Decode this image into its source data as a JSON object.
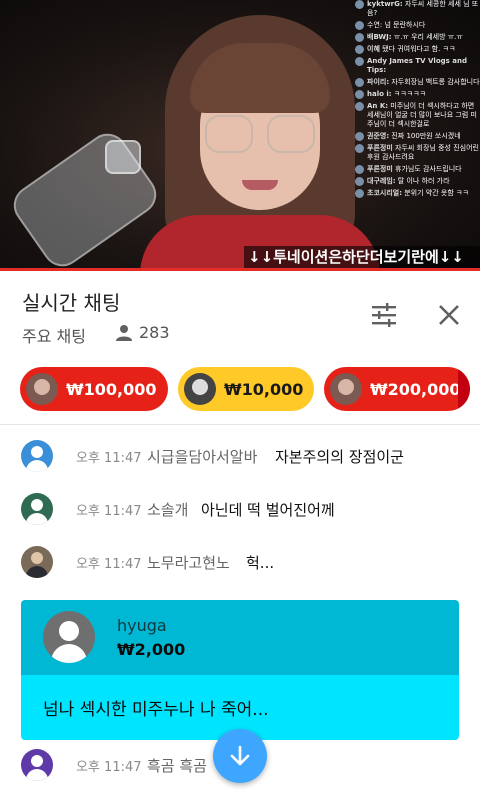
{
  "video": {
    "banner": "↓↓투네이션은하단더보기란에↓↓",
    "overlay_chat": [
      {
        "name": "kyktwrG:",
        "text": "자두씨 세콩한 세세 님 또 음?"
      },
      {
        "name": "",
        "text": "수연: 넘 문란하시다"
      },
      {
        "name": "배BWJ:",
        "text": "ㅠ.ㅠ 우리 세세방 ㅠ.ㅠ"
      },
      {
        "name": "이혜",
        "text": "됐다 귀여워다고 함. ㅋㅋ"
      },
      {
        "name": "Andy James TV Vlogs and Tips:",
        "text": ""
      },
      {
        "name": "파이리:",
        "text": "자두회장님 백트롱 감사합니다"
      },
      {
        "name": "halo i:",
        "text": "ㅋㅋㅋㅋㅋ"
      },
      {
        "name": "An K:",
        "text": "미주님이 더 섹시하다고 하면 세세님이 얼굴 더 많이 보나요 그럼 미주님이 더 섹시한걸로"
      },
      {
        "name": "권준영:",
        "text": "진짜 100만원 쏘시겠네"
      },
      {
        "name": "푸른정미",
        "text": "자두씨 회장님 중성 진심어린 후원 감사드려요"
      },
      {
        "name": "푸른정미",
        "text": "휴가님도 감사드립니다"
      },
      {
        "name": "대구레임:",
        "text": "탈 이나 하러 가라"
      },
      {
        "name": "초코시리얼:",
        "text": "분위기 약간 옷함 ㅋㅋ"
      }
    ]
  },
  "header": {
    "title": "실시간 채팅",
    "subtitle": "주요 채팅",
    "viewer_count": "283"
  },
  "super_chat_pills": [
    {
      "amount": "₩100,000",
      "color": "#e62117"
    },
    {
      "amount": "₩10,000",
      "color": "#ffca28"
    },
    {
      "amount": "₩200,000",
      "color": "#e62117"
    }
  ],
  "messages": [
    {
      "time": "오후 11:47",
      "author": "시급을담아서알바",
      "text": "자본주의의 장점이군",
      "avatar_color": "#3a8fd8"
    },
    {
      "time": "오후 11:47",
      "author": "소솔개",
      "text": "아닌데 떡 벌어진어께",
      "avatar_color": "#2e6b52"
    },
    {
      "time": "오후 11:47",
      "author": "노무라고현노",
      "text": "헉...",
      "avatar_color": "#7a6a58"
    }
  ],
  "super_chat": {
    "name": "hyuga",
    "amount": "₩2,000",
    "message": "넘나 섹시한 미주누나 나 죽어...",
    "header_color": "#00b8d4",
    "body_color": "#00e5ff"
  },
  "last_message": {
    "time": "오후 11:47",
    "author": "흑곰 흑곰",
    "text": "",
    "avatar_color": "#5e3aa8"
  }
}
